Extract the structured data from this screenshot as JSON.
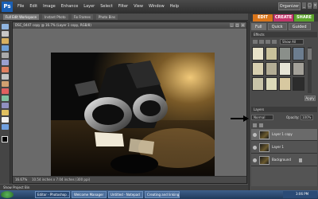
{
  "app": {
    "logo_text": "Ps"
  },
  "menu": [
    "File",
    "Edit",
    "Image",
    "Enhance",
    "Layer",
    "Select",
    "Filter",
    "View",
    "Window",
    "Help"
  ],
  "organizer_label": "Organizer",
  "window_controls": [
    "_",
    "□",
    "×"
  ],
  "subtabs": [
    "Full Edit Workspace",
    "Instant Photo",
    "Fix Frames",
    "Photo Bins"
  ],
  "mode_tabs": [
    {
      "label": "EDIT",
      "color": "#d9751a"
    },
    {
      "label": "CREATE",
      "color": "#c2356a"
    },
    {
      "label": "SHARE",
      "color": "#5ca32b"
    }
  ],
  "document": {
    "title": "DSC_0447 copy @ 16.7% (Layer 1 copy, RGB/8)",
    "zoom": "16.67%",
    "info": "10.54 inches x 7.04 inches (300 ppi)",
    "controls": [
      "_",
      "□",
      "×"
    ]
  },
  "project_bin_label": "Show Project Bin",
  "right_panel": {
    "tabs": [
      "Full",
      "Quick",
      "Guided"
    ],
    "effects_header": "Effects",
    "effects_dropdown": "Show All",
    "apply_label": "Apply",
    "layers_header": "Layers",
    "blend_mode": "Normal",
    "opacity_label": "Opacity:",
    "opacity_value": "100%",
    "layers": [
      {
        "name": "Layer 1 copy",
        "selected": true
      },
      {
        "name": "Layer 1",
        "selected": false
      },
      {
        "name": "Background",
        "selected": false
      }
    ]
  },
  "effect_thumb_colors": [
    "#e8e2c8",
    "#c9c19a",
    "#8a8f8a",
    "#6c7d8f",
    "#d8d0b0",
    "#b3ad95",
    "#e6e4d6",
    "#a4a199",
    "#c8c4a8",
    "#dcdab9",
    "#d7c8a0",
    "#2c2c2c"
  ],
  "taskbar": {
    "buttons": [
      {
        "label": "Editor - Photoshop ...",
        "active": true
      },
      {
        "label": "Welcome Manager",
        "active": false
      },
      {
        "label": "Untitled - Notepad",
        "active": false
      },
      {
        "label": "Creating and linking...",
        "active": false
      }
    ],
    "clock": "3:06 PM"
  }
}
